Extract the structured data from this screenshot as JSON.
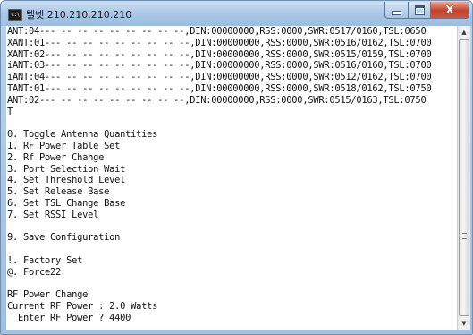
{
  "window": {
    "title": "텔넷 210.210.210.210",
    "app_icon_text": "C:\\",
    "minimize_icon": "minimize-icon",
    "maximize_icon": "maximize-icon",
    "close_icon": "close-icon",
    "close_label": "X"
  },
  "console": {
    "lines": [
      "ANT:04--- -- -- -- -- -- -- -- --,DIN:00000000,RSS:0000,SWR:0517/0160,TSL:0650",
      "XANT:01--- -- -- -- -- -- -- -- --,DIN:00000000,RSS:0000,SWR:0516/0162,TSL:0700",
      "XANT:02--- -- -- -- -- -- -- -- --,DIN:00000000,RSS:0000,SWR:0515/0159,TSL:0700",
      "iANT:03--- -- -- -- -- -- -- -- --,DIN:00000000,RSS:0000,SWR:0516/0160,TSL:0700",
      "iANT:04--- -- -- -- -- -- -- -- --,DIN:00000000,RSS:0000,SWR:0512/0162,TSL:0700",
      "TANT:01--- -- -- -- -- -- -- -- --,DIN:00000000,RSS:0000,SWR:0518/0162,TSL:0750",
      "ANT:02--- -- -- -- -- -- -- -- --,DIN:00000000,RSS:0000,SWR:0515/0163,TSL:0750",
      "T",
      "",
      "0. Toggle Antenna Quantities",
      "1. RF Power Table Set",
      "2. Rf Power Change",
      "3. Port Selection Wait",
      "4. Set Threshold Level",
      "5. Set Release Base",
      "6. Set TSL Change Base",
      "7. Set RSSI Level",
      "",
      "9. Save Configuration",
      "",
      "!. Factory Set",
      "@. Force22",
      "",
      "RF Power Change",
      "Current RF Power : 2.0 Watts",
      "  Enter RF Power ? 4400"
    ]
  },
  "scrollbar": {
    "up_arrow_icon": "scroll-up-arrow-icon",
    "down_arrow_icon": "scroll-down-arrow-icon",
    "up_glyph": "▲",
    "down_glyph": "▼"
  }
}
